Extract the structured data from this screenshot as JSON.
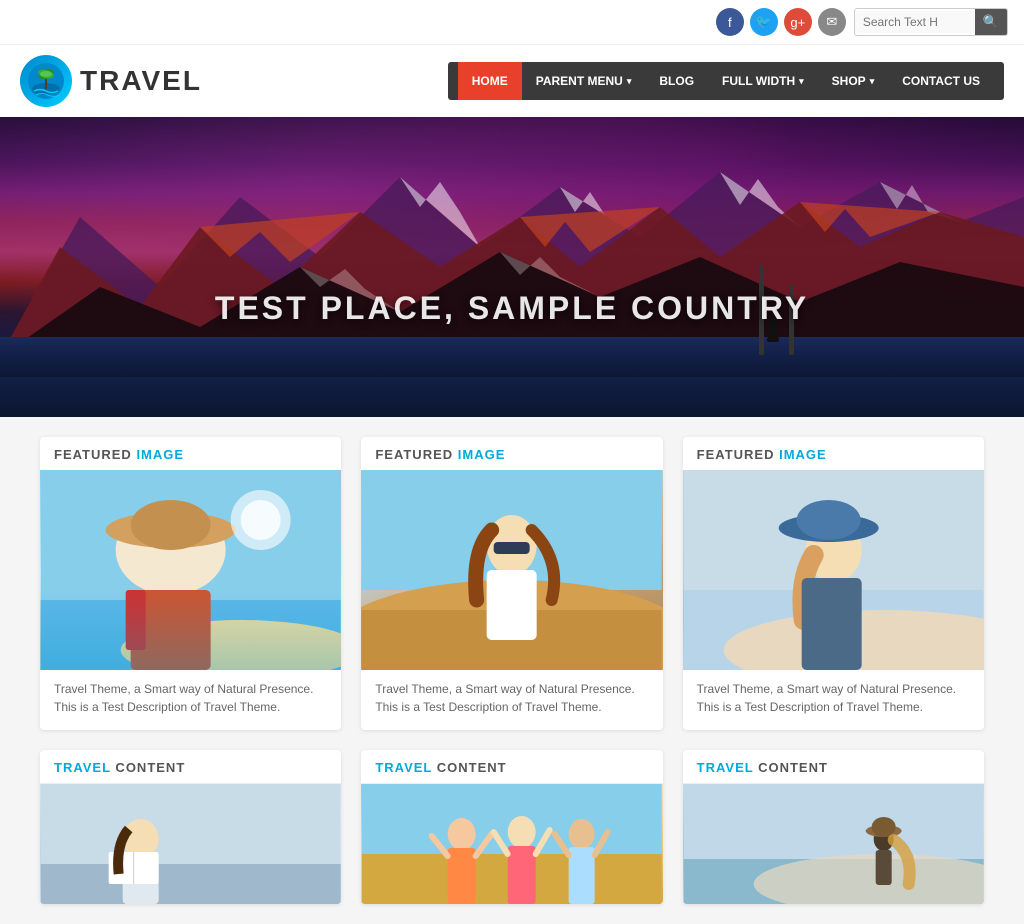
{
  "topbar": {
    "social": {
      "facebook": "f",
      "twitter": "t",
      "googleplus": "g+",
      "email": "✉"
    },
    "search_placeholder": "Search Text H"
  },
  "header": {
    "logo_text": "TRAVEL",
    "nav_items": [
      {
        "label": "HOME",
        "active": true,
        "has_arrow": false
      },
      {
        "label": "PARENT MENU",
        "active": false,
        "has_arrow": true
      },
      {
        "label": "BLOG",
        "active": false,
        "has_arrow": false
      },
      {
        "label": "FULL WIDTH",
        "active": false,
        "has_arrow": true
      },
      {
        "label": "SHOP",
        "active": false,
        "has_arrow": true
      },
      {
        "label": "CONTACT US",
        "active": false,
        "has_arrow": false
      }
    ]
  },
  "hero": {
    "headline": "TEST PLACE, SAMPLE COUNTRY"
  },
  "featured_cards": [
    {
      "title_static": "FEATURED",
      "title_accent": " IMAGE",
      "description": "Travel Theme, a Smart way of Natural Presence. This is a Test Description of Travel Theme."
    },
    {
      "title_static": "FEATURED",
      "title_accent": " IMAGE",
      "description": "Travel Theme, a Smart way of Natural Presence. This is a Test Description of Travel Theme."
    },
    {
      "title_static": "FEATURED",
      "title_accent": " IMAGE",
      "description": "Travel Theme, a Smart way of Natural Presence. This is a Test Description of Travel Theme."
    }
  ],
  "travel_cards": [
    {
      "title_static": "TRAVEL",
      "title_accent": " CONTENT"
    },
    {
      "title_static": "TRAVEL",
      "title_accent": " CONTENT"
    },
    {
      "title_static": "TRAVEL",
      "title_accent": " CONTENT"
    }
  ]
}
